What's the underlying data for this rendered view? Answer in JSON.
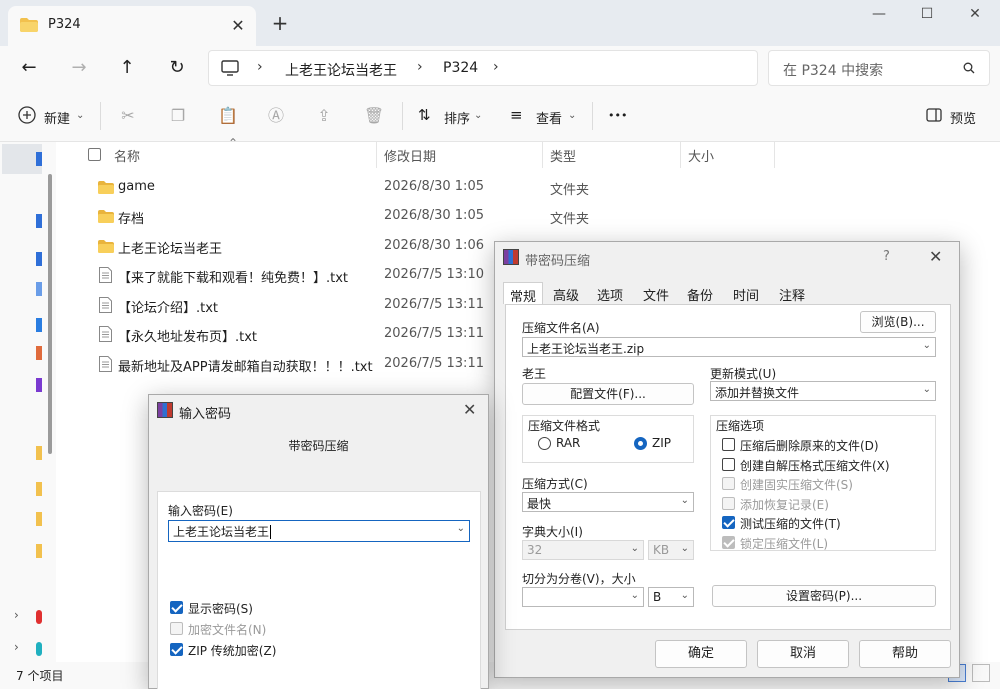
{
  "explorer": {
    "tab_title": "P324",
    "breadcrumb": [
      "上老王论坛当老王",
      "P324"
    ],
    "search_placeholder": "在 P324 中搜索",
    "toolbar": {
      "new": "新建",
      "sort": "排序",
      "view": "查看",
      "more": "•••",
      "preview": "预览"
    },
    "columns": {
      "name": "名称",
      "date": "修改日期",
      "type": "类型",
      "size": "大小"
    },
    "files": [
      {
        "name": "game",
        "date": "2026/8/30 1:05",
        "type": "文件夹",
        "icon": "folder-icon"
      },
      {
        "name": "存档",
        "date": "2026/8/30 1:05",
        "type": "文件夹",
        "icon": "folder-icon"
      },
      {
        "name": "上老王论坛当老王",
        "date": "2026/8/30 1:06",
        "type": "文件夹",
        "icon": "folder-icon"
      },
      {
        "name": "【来了就能下载和观看！纯免费！】.txt",
        "date": "2026/7/5 13:10",
        "type": "",
        "icon": "text-file-icon"
      },
      {
        "name": "【论坛介绍】.txt",
        "date": "2026/7/5 13:11",
        "type": "",
        "icon": "text-file-icon"
      },
      {
        "name": "【永久地址发布页】.txt",
        "date": "2026/7/5 13:11",
        "type": "",
        "icon": "text-file-icon"
      },
      {
        "name": "最新地址及APP请发邮箱自动获取！！！.txt",
        "date": "2026/7/5 13:11",
        "type": "",
        "icon": "text-file-icon"
      }
    ],
    "status": "7 个项目"
  },
  "rar": {
    "title": "带密码压缩",
    "help_glyph": "?",
    "tabs": [
      "常规",
      "高级",
      "选项",
      "文件",
      "备份",
      "时间",
      "注释"
    ],
    "archive_name_label": "压缩文件名(A)",
    "browse": "浏览(B)...",
    "archive_name": "上老王论坛当老王.zip",
    "profile_label": "老王",
    "profile_button": "配置文件(F)...",
    "update_mode_label": "更新模式(U)",
    "update_mode": "添加并替换文件",
    "format_label": "压缩文件格式",
    "format_rar": "RAR",
    "format_zip": "ZIP",
    "options_label": "压缩选项",
    "options": [
      {
        "label": "压缩后删除原来的文件(D)",
        "checked": false,
        "disabled": false
      },
      {
        "label": "创建自解压格式压缩文件(X)",
        "checked": false,
        "disabled": false
      },
      {
        "label": "创建固实压缩文件(S)",
        "checked": false,
        "disabled": true
      },
      {
        "label": "添加恢复记录(E)",
        "checked": false,
        "disabled": true
      },
      {
        "label": "测试压缩的文件(T)",
        "checked": true,
        "disabled": false
      },
      {
        "label": "锁定压缩文件(L)",
        "checked": true,
        "disabled": true
      }
    ],
    "method_label": "压缩方式(C)",
    "method": "最快",
    "dict_label": "字典大小(I)",
    "dict": "32",
    "dict_unit": "KB",
    "split_label": "切分为分卷(V)，大小",
    "split_unit": "B",
    "set_password": "设置密码(P)...",
    "ok": "确定",
    "cancel": "取消",
    "help": "帮助"
  },
  "pwd": {
    "title": "输入密码",
    "subtitle": "带密码压缩",
    "field_label": "输入密码(E)",
    "password": "上老王论坛当老王",
    "options": [
      {
        "label": "显示密码(S)",
        "checked": true,
        "disabled": false
      },
      {
        "label": "加密文件名(N)",
        "checked": false,
        "disabled": true
      },
      {
        "label": "ZIP 传统加密(Z)",
        "checked": true,
        "disabled": false
      }
    ]
  }
}
